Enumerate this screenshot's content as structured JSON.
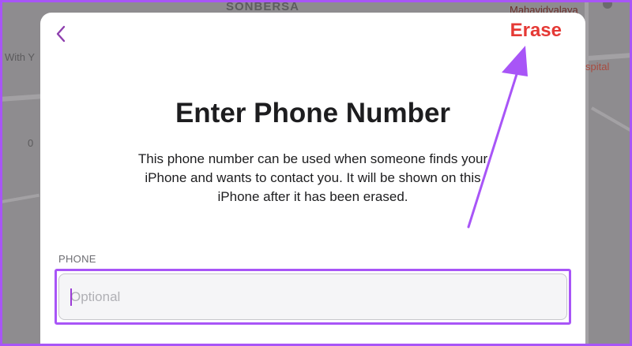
{
  "map": {
    "labels": {
      "town": "SONBERSA",
      "college": "Mahavidyalaya",
      "hospital": "spital",
      "left_text": "With Y",
      "left_number": "0"
    }
  },
  "sheet": {
    "erase_label": "Erase",
    "title": "Enter Phone Number",
    "description": "This phone number can be used when someone finds your iPhone and wants to contact you. It will be shown on this iPhone after it has been erased.",
    "phone": {
      "section_label": "PHONE",
      "placeholder": "Optional",
      "value": ""
    }
  },
  "colors": {
    "erase": "#e53935",
    "accent_highlight": "#a855f7",
    "back_chevron": "#8e3fae"
  }
}
